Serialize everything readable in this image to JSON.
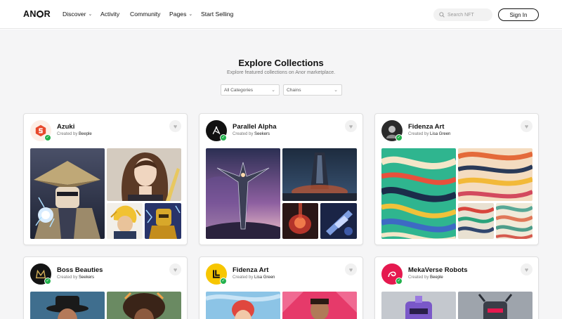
{
  "brand": {
    "logo_pre": "AN",
    "logo_post": "R"
  },
  "nav": {
    "items": [
      {
        "label": "Discover",
        "has_dropdown": true
      },
      {
        "label": "Activity",
        "has_dropdown": false
      },
      {
        "label": "Community",
        "has_dropdown": false
      },
      {
        "label": "Pages",
        "has_dropdown": true
      },
      {
        "label": "Start Selling",
        "has_dropdown": false
      }
    ],
    "search_placeholder": "Search NFT",
    "signin_label": "Sign In"
  },
  "hero": {
    "title": "Explore Collections",
    "subtitle": "Explore featured collections on Anor marketplace."
  },
  "filters": {
    "category": {
      "selected": "All Categories"
    },
    "chains": {
      "selected": "Chains"
    }
  },
  "created_prefix": "Created by ",
  "collections": [
    {
      "name": "Azuki",
      "creator": "Beeple",
      "avatar_icon": "azuki-logo-icon",
      "verified": true
    },
    {
      "name": "Parallel Alpha",
      "creator": "Seekers",
      "avatar_icon": "parallel-logo-icon",
      "verified": true
    },
    {
      "name": "Fidenza Art",
      "creator": "Lisa Green",
      "avatar_icon": "fidenza-avatar-icon",
      "verified": true
    },
    {
      "name": "Boss Beauties",
      "creator": "Seekers",
      "avatar_icon": "boss-beauties-logo-icon",
      "verified": true
    },
    {
      "name": "Fidenza Art",
      "creator": "Lisa Green",
      "avatar_icon": "yellow-l-logo-icon",
      "verified": true
    },
    {
      "name": "MekaVerse Robots",
      "creator": "Beeple",
      "avatar_icon": "mekaverse-logo-icon",
      "verified": true
    }
  ],
  "colors": {
    "verified": "#22b14c",
    "page_background": "#f5f5f6",
    "azuki_accent": "#e8492c",
    "mekaverse_accent": "#e5194f",
    "yellow_logo": "#f7c600"
  }
}
